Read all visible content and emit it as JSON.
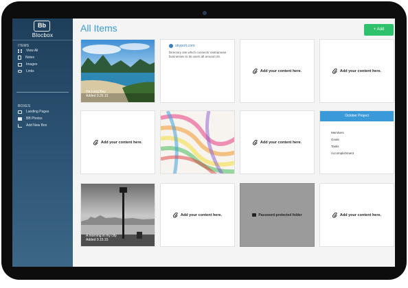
{
  "app": {
    "logo_short": "Bb",
    "logo_name": "Blocbox"
  },
  "sidebar": {
    "items_title": "ITEMS",
    "items": [
      {
        "label": "View All",
        "icon": "grid-icon"
      },
      {
        "label": "Notes",
        "icon": "note-icon"
      },
      {
        "label": "Images",
        "icon": "image-icon"
      },
      {
        "label": "Links",
        "icon": "link-icon"
      }
    ],
    "boxes_title": "BOXES",
    "boxes": [
      {
        "label": "Landing Pages",
        "icon": "box-icon"
      },
      {
        "label": "BB Photos",
        "icon": "photo-icon"
      },
      {
        "label": "Add New Box",
        "icon": "edit-icon"
      }
    ]
  },
  "main": {
    "title": "All Items",
    "add_button": "+ Add",
    "add_content_label": "Add your content here.",
    "cards": {
      "photo1": {
        "caption_title": "Ha Long Bay",
        "caption_sub": "Added 9.26.15"
      },
      "link": {
        "site": "skypoli.com",
        "description": "Directory site which connects Vietnamese businesses to its users all around US."
      },
      "project": {
        "title": "October Project",
        "items": [
          "Members",
          "Goals",
          "Tasks",
          "Accomplishment"
        ]
      },
      "photo2": {
        "caption_title": "A morning in my city",
        "caption_sub": "Added 9.15.15"
      },
      "password": {
        "label": "Password-protected folder"
      }
    }
  },
  "colors": {
    "accent": "#3a9ad9",
    "add_button": "#2ec26d",
    "sidebar": "#2d5475"
  }
}
